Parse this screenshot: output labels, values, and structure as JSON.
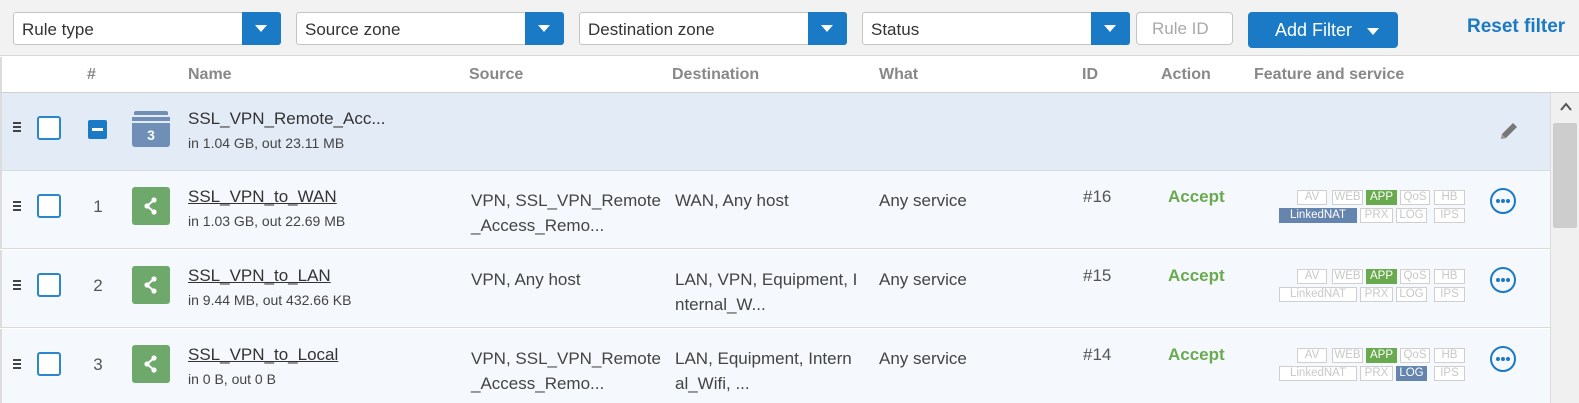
{
  "filters": {
    "rule_type": "Rule type",
    "source_zone": "Source zone",
    "destination_zone": "Destination zone",
    "status": "Status",
    "rule_id_placeholder": "Rule ID",
    "add_filter": "Add Filter",
    "reset_filter": "Reset filter"
  },
  "columns": {
    "num": "#",
    "name": "Name",
    "source": "Source",
    "destination": "Destination",
    "what": "What",
    "id": "ID",
    "action": "Action",
    "feature": "Feature and service"
  },
  "group": {
    "name": "SSL_VPN_Remote_Acc...",
    "traffic": "in 1.04 GB, out 23.11 MB",
    "count": "3"
  },
  "rules": [
    {
      "num": "1",
      "name": "SSL_VPN_to_WAN",
      "traffic": "in 1.03 GB, out 22.69 MB",
      "source": [
        "VPN, SSL_VPN_Remote",
        "_Access_Remo..."
      ],
      "destination": [
        "WAN, Any host",
        ""
      ],
      "what": "Any service",
      "id": "#16",
      "action": "Accept",
      "active": {
        "APP": "green",
        "LinkedNAT": "blue"
      }
    },
    {
      "num": "2",
      "name": "SSL_VPN_to_LAN",
      "traffic": "in 9.44 MB, out 432.66 KB",
      "source": [
        "VPN, Any host",
        ""
      ],
      "destination": [
        "LAN, VPN, Equipment, I",
        "nternal_W..."
      ],
      "what": "Any service",
      "id": "#15",
      "action": "Accept",
      "active": {
        "APP": "green"
      }
    },
    {
      "num": "3",
      "name": "SSL_VPN_to_Local",
      "traffic": "in 0 B, out 0 B",
      "source": [
        "VPN, SSL_VPN_Remote",
        "_Access_Remo..."
      ],
      "destination": [
        "LAN, Equipment, Intern",
        "al_Wifi, ..."
      ],
      "what": "Any service",
      "id": "#14",
      "action": "Accept",
      "active": {
        "APP": "green",
        "LOG": "blue"
      }
    }
  ],
  "feature_tags": [
    "AV",
    "WEB",
    "APP",
    "QoS",
    "HB",
    "LinkedNAT",
    "PRX",
    "LOG",
    "IPS"
  ],
  "icons": {
    "dropdown": "chevron-down-icon",
    "grip": "drag-handle-icon",
    "group": "rule-group-icon",
    "rule": "share-network-icon",
    "edit": "pencil-icon",
    "more": "more-options-icon",
    "scroll_up": "scroll-up-icon"
  },
  "colors": {
    "accent": "#1a7ac6",
    "accept": "#6aaa4f",
    "tag_green": "#6aaa4f",
    "tag_blue": "#6585ae",
    "group_row": "#e3ecf6"
  }
}
